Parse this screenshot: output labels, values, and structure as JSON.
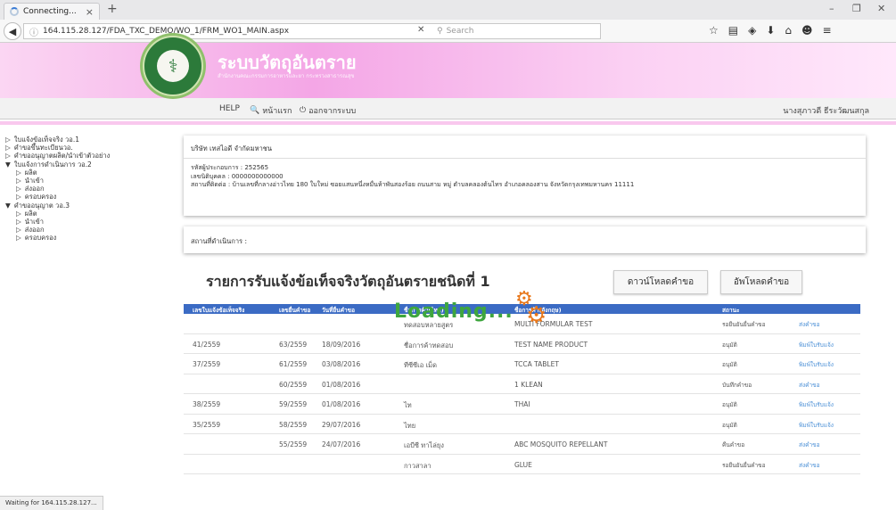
{
  "browser": {
    "tab_title": "Connecting...",
    "tab_close": "×",
    "new_tab": "+",
    "url": "164.115.28.127/FDA_TXC_DEMO/WO_1/FRM_WO1_MAIN.aspx",
    "search_placeholder": "Search",
    "status_text": "Waiting for 164.115.28.127..."
  },
  "site": {
    "title": "ระบบวัตถุอันตราย",
    "subtitle": "สำนักงานคณะกรรมการอาหารและยา กระทรวงสาธารณสุข",
    "menu": {
      "help": "HELP",
      "home": "หน้าแรก",
      "logout": "ออกจากระบบ"
    },
    "user": "นางสุภาวดี ธีระวัฒนสกุล"
  },
  "sidebar": {
    "items": [
      {
        "label": "ใบแจ้งข้อเท็จจริง วอ.1",
        "level": 0,
        "arrow": "▷"
      },
      {
        "label": "คำขอขึ้นทะเบียนวอ.",
        "level": 0,
        "arrow": "▷"
      },
      {
        "label": "คำขออนุญาตผลิต/นำเข้าตัวอย่าง",
        "level": 0,
        "arrow": "▷"
      },
      {
        "label": "ใบแจ้งการดำเนินการ วอ.2",
        "level": 0,
        "arrow": "▼"
      },
      {
        "label": "ผลิต",
        "level": 1,
        "arrow": "▷"
      },
      {
        "label": "นำเข้า",
        "level": 1,
        "arrow": "▷"
      },
      {
        "label": "ส่งออก",
        "level": 1,
        "arrow": "▷"
      },
      {
        "label": "ครอบครอง",
        "level": 1,
        "arrow": "▷"
      },
      {
        "label": "คำขออนุญาต วอ.3",
        "level": 0,
        "arrow": "▼"
      },
      {
        "label": "ผลิต",
        "level": 1,
        "arrow": "▷"
      },
      {
        "label": "นำเข้า",
        "level": 1,
        "arrow": "▷"
      },
      {
        "label": "ส่งออก",
        "level": 1,
        "arrow": "▷"
      },
      {
        "label": "ครอบครอง",
        "level": 1,
        "arrow": "▷"
      }
    ]
  },
  "company": {
    "name": "บริษัท เทสไอดี จำกัดมหาชน",
    "operator_id": "รหัสผู้ประกอบการ : 252565",
    "juristic_id": "เลขนิติบุคคล : 0000000000000",
    "address": "สถานที่ติดต่อ : บ้านเลขที่กลางอ่าวไทย 180 ใบใหม่ ซอยแสนหนึ่งหมื่นห้าพันสองร้อย ถนนสาม หมู่ ตำบลคลองต้นไทร อำเภอคลองสาน จังหวัดกรุงเทพมหานคร 11111"
  },
  "operation_place": "สถานที่ดำเนินการ :",
  "main": {
    "title": "รายการรับแจ้งข้อเท็จจริงวัตถุอันตรายชนิดที่ 1",
    "download_button": "ดาวน์โหลดคำขอ",
    "upload_button": "อัพโหลดคำขอ",
    "loading_text": "Loading...",
    "columns": [
      "เลขใบแจ้งข้อเท็จจริง",
      "เลขยื่นคำขอ",
      "วันที่ยื่นคำขอ",
      "ชื่อการค้า(ไทย)",
      "ชื่อการค้า(อังกฤษ)",
      "สถานะ",
      ""
    ],
    "rows": [
      {
        "cert": "",
        "req": "",
        "date": "",
        "th": "ทดสอบหลายสูตร",
        "en": "MULTI FORMULAR TEST",
        "status": "รอยืนยันยื่นคำขอ",
        "action": "ส่งคำขอ"
      },
      {
        "cert": "41/2559",
        "req": "63/2559",
        "date": "18/09/2016",
        "th": "ชื่อการค้าทดสอบ",
        "en": "TEST NAME PRODUCT",
        "status": "อนุมัติ",
        "action": "พิมพ์ใบรับแจ้ง"
      },
      {
        "cert": "37/2559",
        "req": "61/2559",
        "date": "03/08/2016",
        "th": "ทีซีซีเอ เม็ด",
        "en": "TCCA TABLET",
        "status": "อนุมัติ",
        "action": "พิมพ์ใบรับแจ้ง"
      },
      {
        "cert": "",
        "req": "60/2559",
        "date": "01/08/2016",
        "th": "",
        "en": "1 KLEAN",
        "status": "บันทึกคำขอ",
        "action": "ส่งคำขอ"
      },
      {
        "cert": "38/2559",
        "req": "59/2559",
        "date": "01/08/2016",
        "th": "ไท",
        "en": "THAI",
        "status": "อนุมัติ",
        "action": "พิมพ์ใบรับแจ้ง"
      },
      {
        "cert": "35/2559",
        "req": "58/2559",
        "date": "29/07/2016",
        "th": "ไทย",
        "en": "",
        "status": "อนุมัติ",
        "action": "พิมพ์ใบรับแจ้ง"
      },
      {
        "cert": "",
        "req": "55/2559",
        "date": "24/07/2016",
        "th": "เอบีซี ทาไล่ยุง",
        "en": "ABC MOSQUITO REPELLANT",
        "status": "คืนคำขอ",
        "action": "ส่งคำขอ"
      },
      {
        "cert": "",
        "req": "",
        "date": "",
        "th": "กาวสาลา",
        "en": "GLUE",
        "status": "รอยืนยันยื่นคำขอ",
        "action": "ส่งคำขอ"
      }
    ]
  }
}
